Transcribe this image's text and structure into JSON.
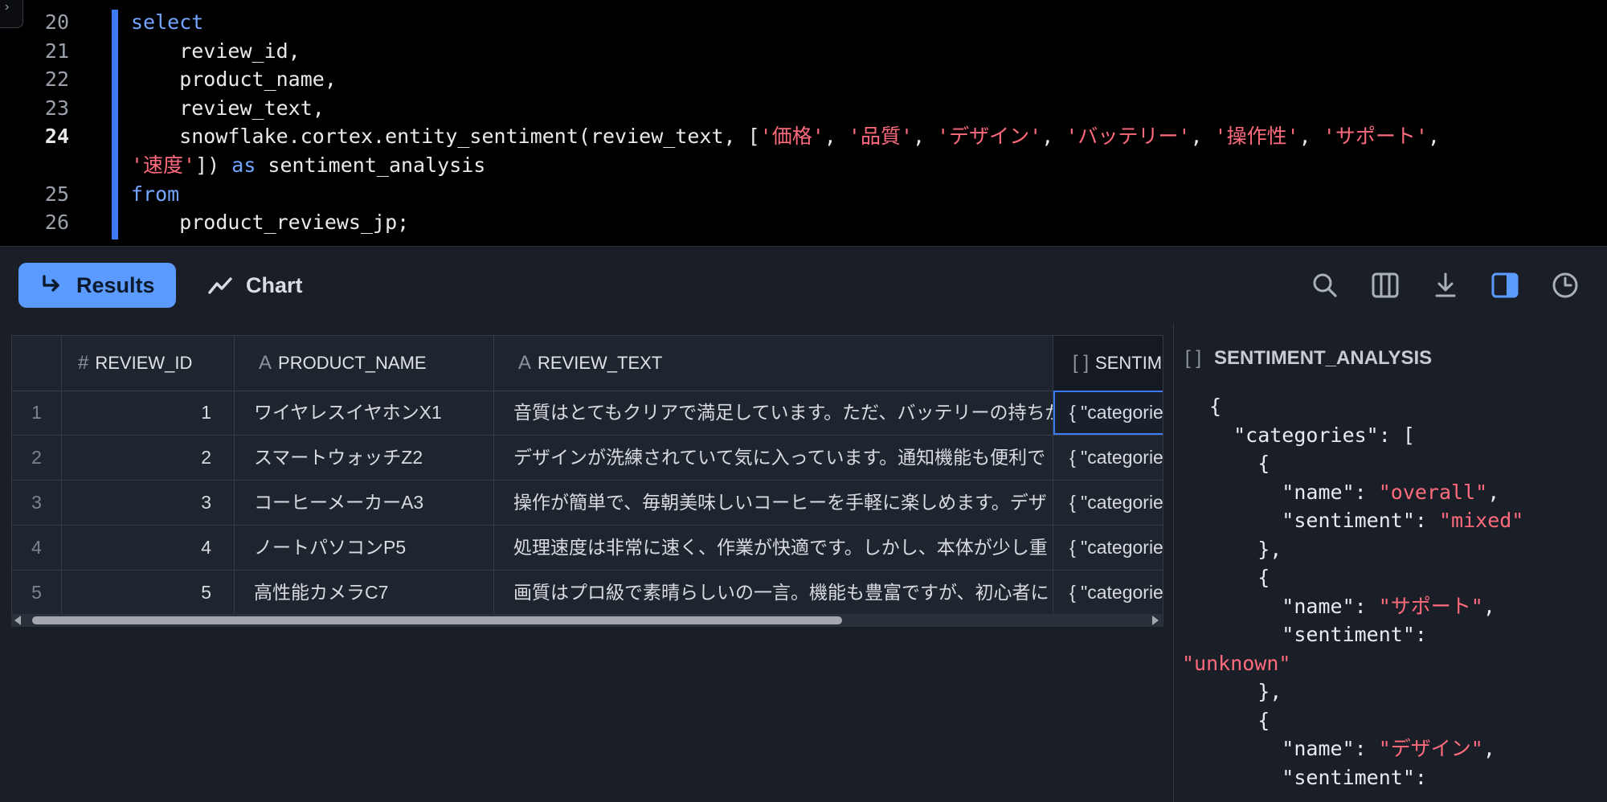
{
  "editor": {
    "lines": [
      {
        "num": "20",
        "parts": [
          {
            "t": "select",
            "c": "kw"
          }
        ]
      },
      {
        "num": "21",
        "parts": [
          {
            "t": "    review_id,",
            "c": "plain"
          }
        ]
      },
      {
        "num": "22",
        "parts": [
          {
            "t": "    product_name,",
            "c": "plain"
          }
        ]
      },
      {
        "num": "23",
        "parts": [
          {
            "t": "    review_text,",
            "c": "plain"
          }
        ]
      },
      {
        "num": "24",
        "current": true,
        "parts": [
          {
            "t": "    snowflake.cortex.entity_sentiment(review_text, [",
            "c": "plain"
          },
          {
            "t": "'価格'",
            "c": "str"
          },
          {
            "t": ", ",
            "c": "plain"
          },
          {
            "t": "'品質'",
            "c": "str"
          },
          {
            "t": ", ",
            "c": "plain"
          },
          {
            "t": "'デザイン'",
            "c": "str"
          },
          {
            "t": ", ",
            "c": "plain"
          },
          {
            "t": "'バッテリー'",
            "c": "str"
          },
          {
            "t": ", ",
            "c": "plain"
          },
          {
            "t": "'操作性'",
            "c": "str"
          },
          {
            "t": ", ",
            "c": "plain"
          },
          {
            "t": "'サポート'",
            "c": "str"
          },
          {
            "t": ",",
            "c": "plain"
          }
        ]
      },
      {
        "num": "",
        "parts": [
          {
            "t": "'速度'",
            "c": "str"
          },
          {
            "t": "]) ",
            "c": "plain"
          },
          {
            "t": "as",
            "c": "kw"
          },
          {
            "t": " sentiment_analysis",
            "c": "plain"
          }
        ]
      },
      {
        "num": "25",
        "parts": [
          {
            "t": "from",
            "c": "kw"
          }
        ]
      },
      {
        "num": "26",
        "parts": [
          {
            "t": "    product_reviews_jp;",
            "c": "plain"
          }
        ]
      }
    ]
  },
  "toolbar": {
    "results_label": "Results",
    "chart_label": "Chart",
    "icons": [
      "search-icon",
      "columns-icon",
      "download-icon",
      "panel-toggle-icon",
      "history-icon"
    ]
  },
  "table": {
    "columns": [
      {
        "label": "REVIEW_ID",
        "type_icon": "#"
      },
      {
        "label": "PRODUCT_NAME",
        "type_icon": "A"
      },
      {
        "label": "REVIEW_TEXT",
        "type_icon": "A"
      },
      {
        "label": "SENTIMENT_ANALYSIS",
        "type_icon": "[ ]"
      }
    ],
    "rows": [
      {
        "n": "1",
        "id": "1",
        "name": "ワイヤレスイヤホンX1",
        "text": "音質はとてもクリアで満足しています。ただ、バッテリーの持ちが",
        "sent": "{  \"categories\": ["
      },
      {
        "n": "2",
        "id": "2",
        "name": "スマートウォッチZ2",
        "text": "デザインが洗練されていて気に入っています。通知機能も便利で",
        "sent": "{  \"categories\": ["
      },
      {
        "n": "3",
        "id": "3",
        "name": "コーヒーメーカーA3",
        "text": "操作が簡単で、毎朝美味しいコーヒーを手軽に楽しめます。デザ",
        "sent": "{  \"categories\": ["
      },
      {
        "n": "4",
        "id": "4",
        "name": "ノートパソコンP5",
        "text": "処理速度は非常に速く、作業が快適です。しかし、本体が少し重",
        "sent": "{  \"categories\": ["
      },
      {
        "n": "5",
        "id": "5",
        "name": "高性能カメラC7",
        "text": "画質はプロ級で素晴らしいの一言。機能も豊富ですが、初心者に",
        "sent": "{  \"categories\": ["
      }
    ]
  },
  "detail": {
    "title": "SENTIMENT_ANALYSIS",
    "type_icon": "[ ]",
    "json_lines": [
      [
        {
          "t": "{",
          "s": false
        }
      ],
      [
        {
          "t": "  \"categories\": [",
          "s": false
        }
      ],
      [
        {
          "t": "    {",
          "s": false
        }
      ],
      [
        {
          "t": "      \"name\": ",
          "s": false
        },
        {
          "t": "\"overall\"",
          "s": true
        },
        {
          "t": ",",
          "s": false
        }
      ],
      [
        {
          "t": "      \"sentiment\": ",
          "s": false
        },
        {
          "t": "\"mixed\"",
          "s": true
        }
      ],
      [
        {
          "t": "    },",
          "s": false
        }
      ],
      [
        {
          "t": "    {",
          "s": false
        }
      ],
      [
        {
          "t": "      \"name\": ",
          "s": false
        },
        {
          "t": "\"サポート\"",
          "s": true
        },
        {
          "t": ",",
          "s": false
        }
      ],
      [
        {
          "t": "      \"sentiment\":",
          "s": false
        }
      ],
      [
        {
          "t": "\"unknown\"",
          "s": true
        }
      ],
      [
        {
          "t": "    },",
          "s": false
        }
      ],
      [
        {
          "t": "    {",
          "s": false
        }
      ],
      [
        {
          "t": "      \"name\": ",
          "s": false
        },
        {
          "t": "\"デザイン\"",
          "s": true
        },
        {
          "t": ",",
          "s": false
        }
      ],
      [
        {
          "t": "      \"sentiment\":",
          "s": false
        }
      ]
    ]
  },
  "colors": {
    "accent": "#5b9bff",
    "keyword": "#73a6ff",
    "string": "#ff6b7d",
    "panel_bg": "#1a1f27"
  }
}
